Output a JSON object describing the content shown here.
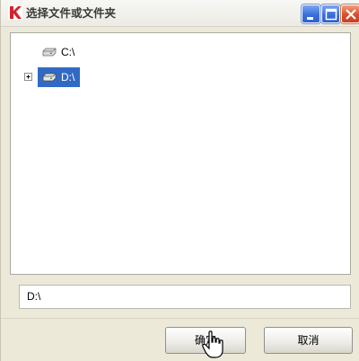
{
  "window": {
    "title": "选择文件或文件夹",
    "app_icon": "kaspersky-k-icon",
    "controls": [
      "minimize-icon",
      "maximize-icon",
      "close-icon"
    ]
  },
  "tree": {
    "items": [
      {
        "label": "C:\\",
        "icon": "drive-icon",
        "selected": false,
        "expandable": false
      },
      {
        "label": "D:\\",
        "icon": "drive-icon",
        "selected": true,
        "expandable": true
      }
    ],
    "selection_color": "#316ac5"
  },
  "path_field": {
    "value": "D:\\"
  },
  "buttons": {
    "ok_label": "确定",
    "cancel_label": "取消"
  },
  "cursor": {
    "icon": "hand-pointer-icon"
  }
}
